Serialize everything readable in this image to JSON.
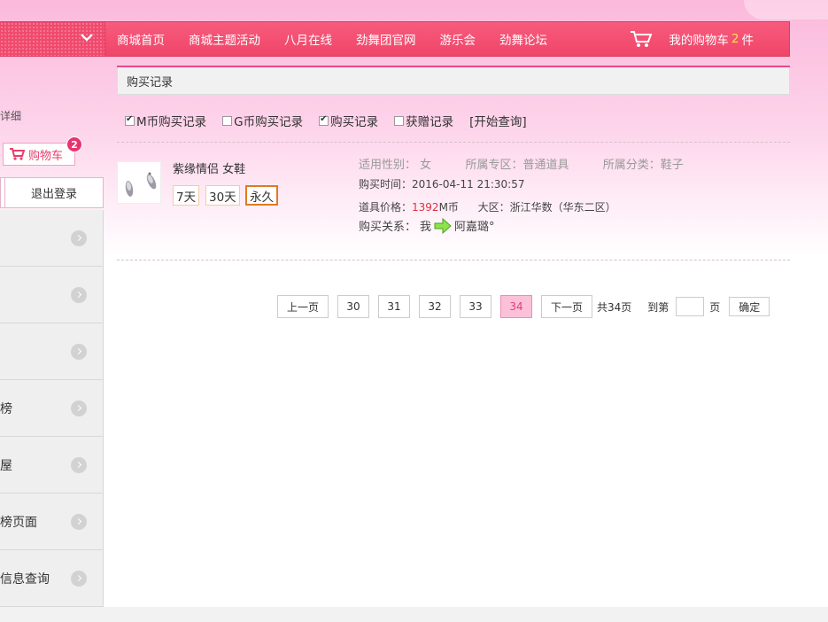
{
  "nav": {
    "items": [
      "商城首页",
      "商城主题活动",
      "八月在线",
      "劲舞团官网",
      "游乐会",
      "劲舞论坛"
    ],
    "cart_prefix": "我的购物车",
    "cart_count": "2",
    "cart_suffix": "件"
  },
  "sidebar": {
    "detail_text": "详细",
    "cart_label": "购物车",
    "cart_badge": "2",
    "logout_label": "退出登录",
    "menu": [
      "",
      "",
      "",
      "榜",
      "屋",
      "榜页面",
      "信息查询"
    ]
  },
  "main": {
    "title": "购买记录",
    "filters": [
      {
        "label": "M币购买记录",
        "checked": true
      },
      {
        "label": "G币购买记录",
        "checked": false
      },
      {
        "label": "购买记录",
        "checked": true
      },
      {
        "label": "获赠记录",
        "checked": false
      }
    ],
    "query_label": "[开始查询]",
    "record": {
      "name": "紫缘情侣 女鞋",
      "durations": [
        "7天",
        "30天",
        "永久"
      ],
      "selected_duration": "永久",
      "gender_label": "适用性别：",
      "gender": "女",
      "zone_label": "所属专区：",
      "zone": "普通道具",
      "category_label": "所属分类：",
      "category": "鞋子",
      "time_label": "购买时间：",
      "time": "2016-04-11 21:30:57",
      "price_label": "道具价格：",
      "price": "1392",
      "price_unit": "M币",
      "region_label": "大区：",
      "region": "浙江华数（华东二区）",
      "relation_label": "购买关系：",
      "relation_from": "我",
      "relation_to": "阿嘉璐°"
    }
  },
  "pager": {
    "prev": "上一页",
    "pages": [
      "30",
      "31",
      "32",
      "33",
      "34"
    ],
    "current": "34",
    "next": "下一页",
    "total": "共34页",
    "goto_prefix": "到第",
    "goto_suffix": "页",
    "confirm": "确定"
  },
  "colors": {
    "accent": "#f04a6e",
    "price": "#e0303f",
    "cart_count": "#ffe24a"
  }
}
